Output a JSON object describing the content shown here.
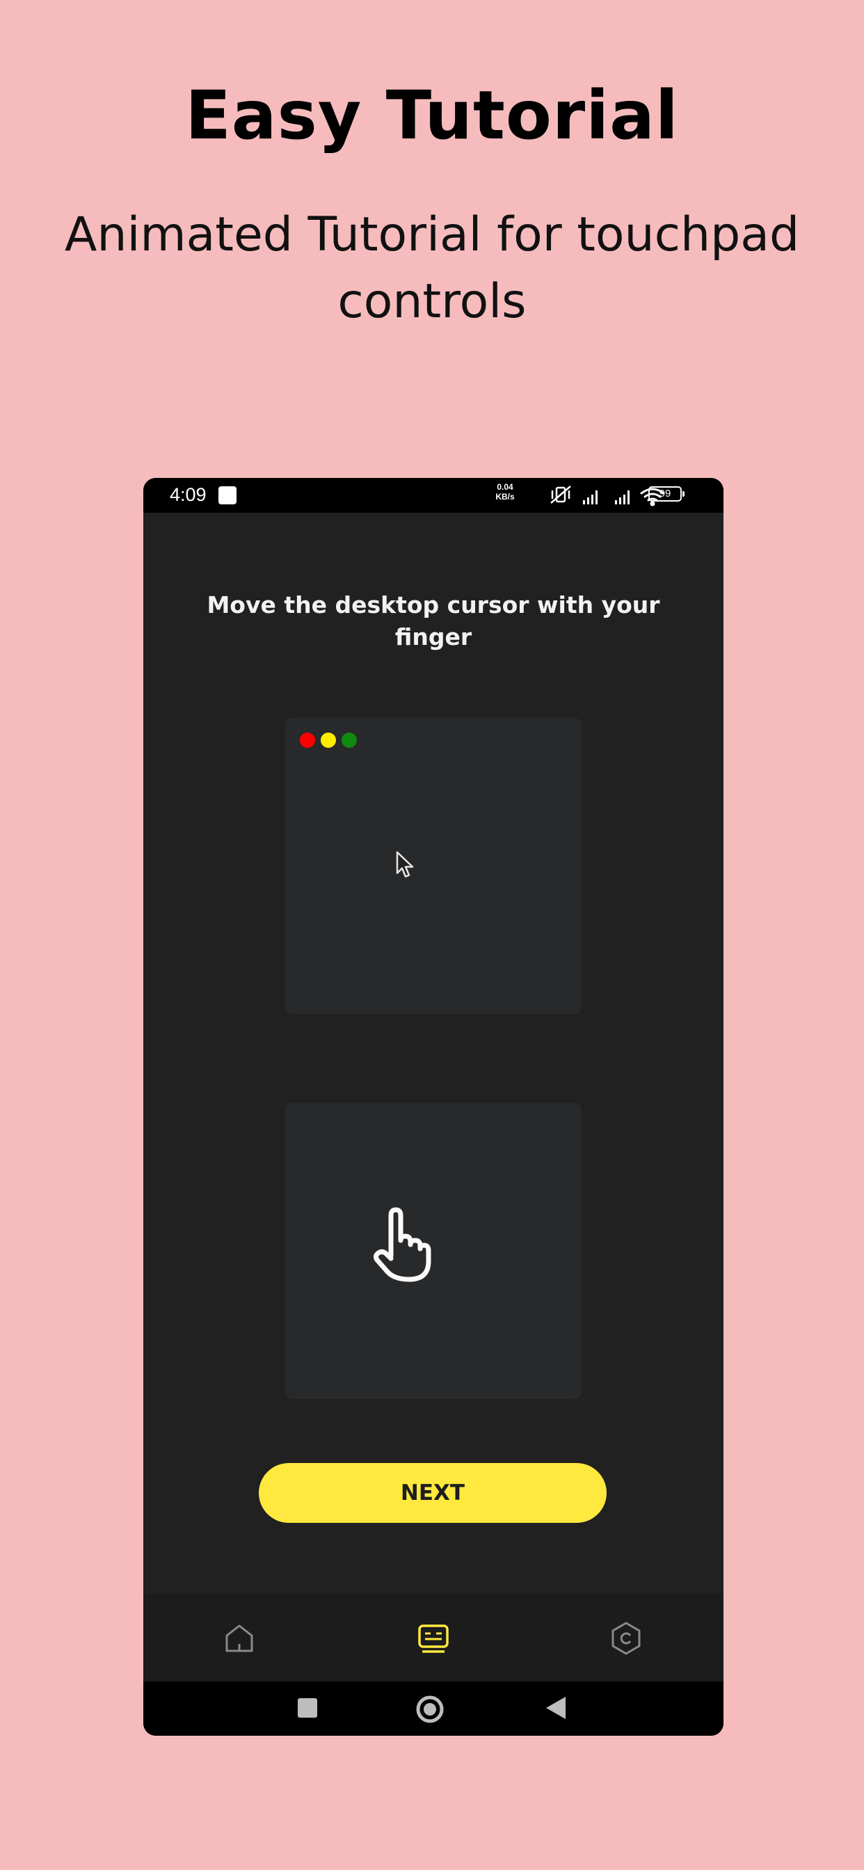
{
  "promo": {
    "headline": "Easy Tutorial",
    "subheadline": "Animated Tutorial for touchpad controls"
  },
  "status_bar": {
    "time": "4:09",
    "network_speed_value": "0.04",
    "network_speed_unit": "KB/s",
    "battery": "99"
  },
  "tutorial": {
    "instruction": "Move the desktop cursor with your finger",
    "window_dots": [
      "#ff0000",
      "#ffee00",
      "#118a11"
    ]
  },
  "next_button": {
    "label": "NEXT",
    "color": "#ffe93f"
  },
  "bottom_nav": {
    "items": [
      {
        "icon": "home-icon",
        "active": false
      },
      {
        "icon": "tutorial-icon",
        "active": true
      },
      {
        "icon": "settings-icon",
        "active": false
      }
    ],
    "active_color": "#ffe93f",
    "inactive_color": "#8a8a8a"
  },
  "system_nav": {
    "items": [
      "recents-square-icon",
      "home-circle-icon",
      "back-triangle-icon"
    ]
  }
}
